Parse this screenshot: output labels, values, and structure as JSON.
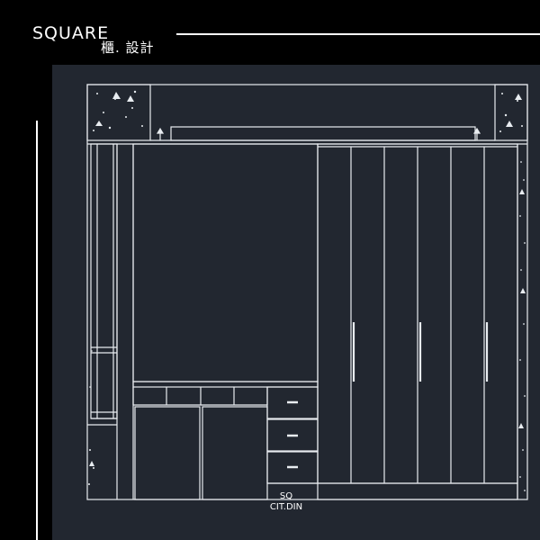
{
  "header": {
    "brand": "SQUARE",
    "subtitle": "櫃. 設計"
  },
  "drawing": {
    "code_line1": "SQ",
    "code_line2": "CIT.DIN",
    "colors": {
      "background": "#000000",
      "panel": "#222730",
      "line": "#e8ecf0"
    }
  }
}
